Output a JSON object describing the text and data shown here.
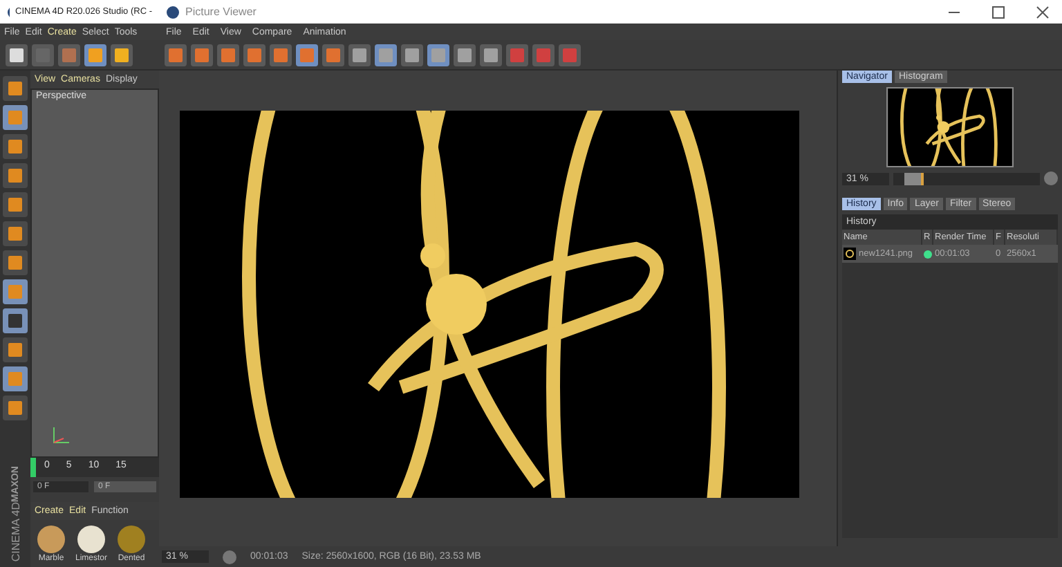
{
  "background_window": {
    "title": "CINEMA 4D R20.026 Studio (RC -",
    "menu": [
      "File",
      "Edit",
      "Create",
      "Select",
      "Tools"
    ],
    "viewport_menu": [
      "View",
      "Cameras",
      "Display"
    ],
    "viewport_label": "Perspective",
    "timeline_ticks": [
      "0",
      "5",
      "10",
      "15"
    ],
    "frame_field": "0 F",
    "frame_field_2": "0 F",
    "material_menu": [
      "Create",
      "Edit",
      "Function"
    ],
    "materials": [
      {
        "name": "Marble",
        "color": "#c89a5a"
      },
      {
        "name": "Limestor",
        "color": "#e8e2d0"
      },
      {
        "name": "Dented",
        "color": "#a08020"
      }
    ],
    "logo": [
      "MAXON",
      "CINEMA 4D"
    ]
  },
  "window": {
    "title": "Picture Viewer"
  },
  "menu": [
    "File",
    "Edit",
    "View",
    "Compare",
    "Animation"
  ],
  "navigator": {
    "tabs": [
      {
        "label": "Navigator",
        "selected": true
      },
      {
        "label": "Histogram",
        "selected": false
      }
    ],
    "zoom": "31 %",
    "level": 0.08
  },
  "history": {
    "tabs": [
      {
        "label": "History",
        "selected": true
      },
      {
        "label": "Info",
        "selected": false
      },
      {
        "label": "Layer",
        "selected": false
      },
      {
        "label": "Filter",
        "selected": false
      },
      {
        "label": "Stereo",
        "selected": false
      }
    ],
    "title": "History",
    "columns": [
      "Name",
      "R",
      "Render Time",
      "F",
      "Resoluti"
    ],
    "rows": [
      {
        "name": "new1241.png",
        "selected": true,
        "rendered": true,
        "render_time": "00:01:03",
        "frame": "0",
        "resolution": "2560x1"
      }
    ]
  },
  "status_bar": {
    "zoom": "31 %",
    "time": "00:01:03",
    "info": "Size: 2560x1600, RGB (16 Bit), 23.53 MB"
  }
}
